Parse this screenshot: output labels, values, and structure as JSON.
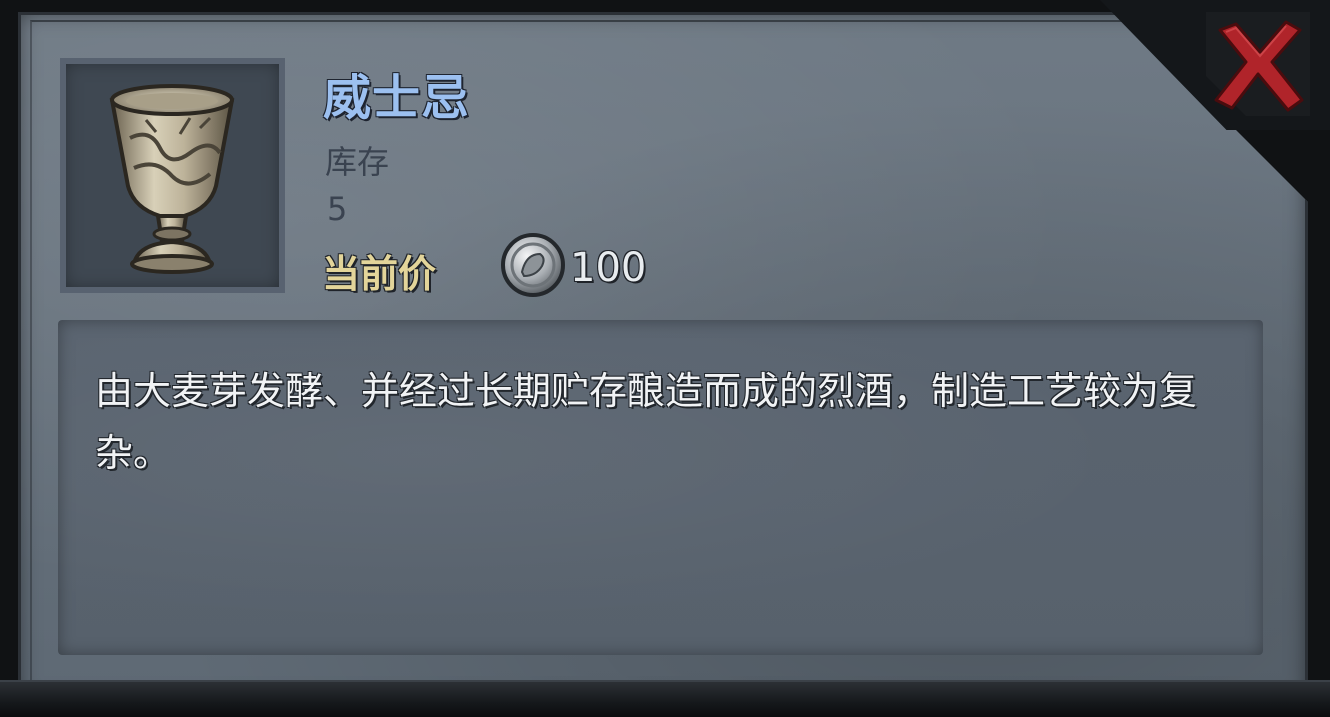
{
  "item": {
    "name": "威士忌",
    "icon": "goblet-icon",
    "stock_label": "库存",
    "stock_value": "5",
    "price_label": "当前价",
    "price_currency_icon": "silver-coin-icon",
    "price_value": "100",
    "description": "由大麦芽发酵、并经过长期贮存酿造而成的烈酒，制造工艺较为复杂。"
  },
  "colors": {
    "title": "#9cc0f0",
    "price_label": "#e3d59a",
    "close_x": "#c0282a",
    "panel": "#6f7a85"
  }
}
